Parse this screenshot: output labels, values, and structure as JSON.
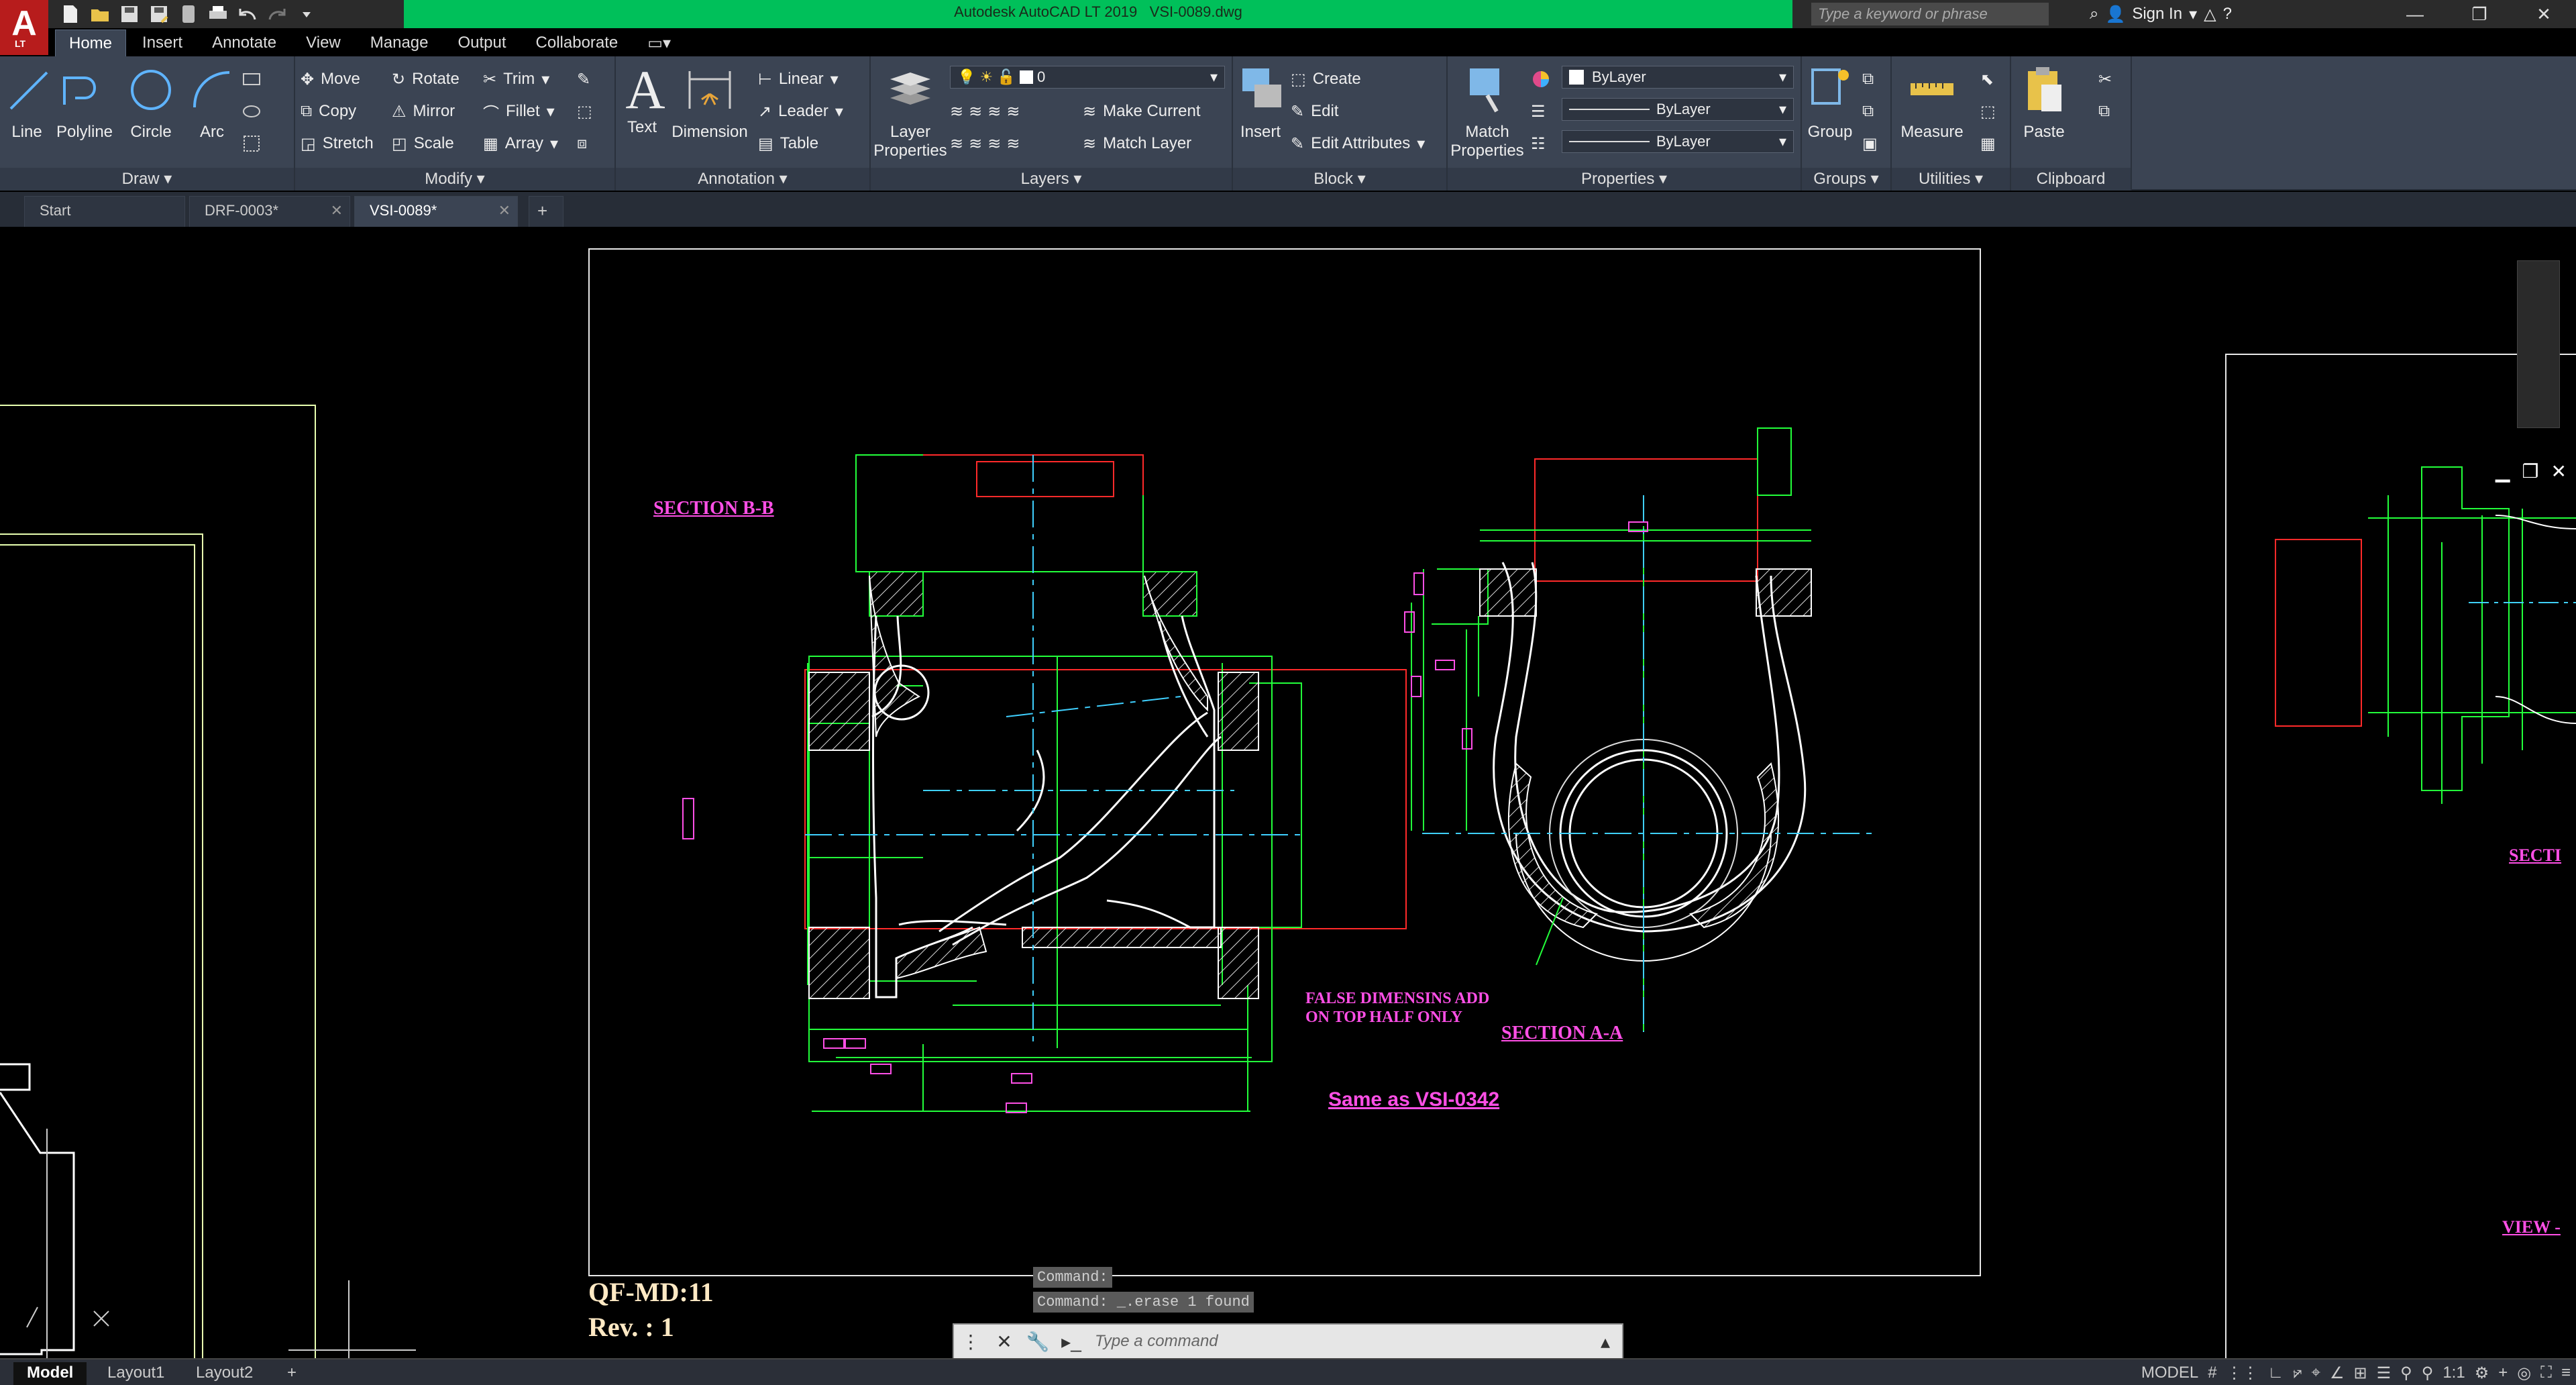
{
  "window": {
    "app_title": "Autodesk AutoCAD LT 2019",
    "doc_title": "VSI-0089.dwg",
    "logo": "A",
    "logo_sub": "LT",
    "search_placeholder": "Type a keyword or phrase",
    "sign_in": "Sign In"
  },
  "ribbon_tabs": [
    "Home",
    "Insert",
    "Annotate",
    "View",
    "Manage",
    "Output",
    "Collaborate"
  ],
  "panels": {
    "draw": {
      "title": "Draw",
      "line": "Line",
      "polyline": "Polyline",
      "circle": "Circle",
      "arc": "Arc"
    },
    "modify": {
      "title": "Modify",
      "move": "Move",
      "rotate": "Rotate",
      "trim": "Trim",
      "copy": "Copy",
      "mirror": "Mirror",
      "fillet": "Fillet",
      "stretch": "Stretch",
      "scale": "Scale",
      "array": "Array"
    },
    "annotation": {
      "title": "Annotation",
      "text": "Text",
      "dimension": "Dimension",
      "linear": "Linear",
      "leader": "Leader",
      "table": "Table"
    },
    "layers": {
      "title": "Layers",
      "layer_properties_1": "Layer",
      "layer_properties_2": "Properties",
      "current_layer": "0",
      "make_current": "Make Current",
      "match_layer": "Match Layer"
    },
    "block": {
      "title": "Block",
      "insert": "Insert",
      "create": "Create",
      "edit": "Edit",
      "edit_attributes": "Edit Attributes"
    },
    "properties": {
      "title": "Properties",
      "match_1": "Match",
      "match_2": "Properties",
      "color": "ByLayer",
      "linetype": "ByLayer",
      "lineweight": "ByLayer"
    },
    "groups": {
      "title": "Groups",
      "group": "Group"
    },
    "utilities": {
      "title": "Utilities",
      "measure": "Measure"
    },
    "clipboard": {
      "title": "Clipboard",
      "paste": "Paste"
    }
  },
  "file_tabs": [
    "Start",
    "DRF-0003*",
    "VSI-0089*"
  ],
  "drawing": {
    "section_bb": "SECTION B-B",
    "section_aa": "SECTION A-A",
    "false_dims_1": "FALSE DIMENSINS ADD",
    "false_dims_2": "ON TOP HALF ONLY",
    "same_as": "Same as VSI-0342",
    "qf": "QF-MD:11",
    "rev": "Rev. : 1",
    "right_section": "SECTI",
    "right_view": "VIEW -"
  },
  "command": {
    "history": [
      "Command:",
      "Command: _.erase 1 found"
    ],
    "placeholder": "Type a command"
  },
  "status": {
    "layout_tabs": [
      "Model",
      "Layout1",
      "Layout2"
    ],
    "mode": "MODEL",
    "scale": "1:1"
  },
  "colors": {
    "ribbon": "#3b4453",
    "titlebar_accent": "#00c05a",
    "green_geom": "#22ff3a",
    "magenta": "#ff4fe6",
    "red_line": "#ff2a2a"
  }
}
